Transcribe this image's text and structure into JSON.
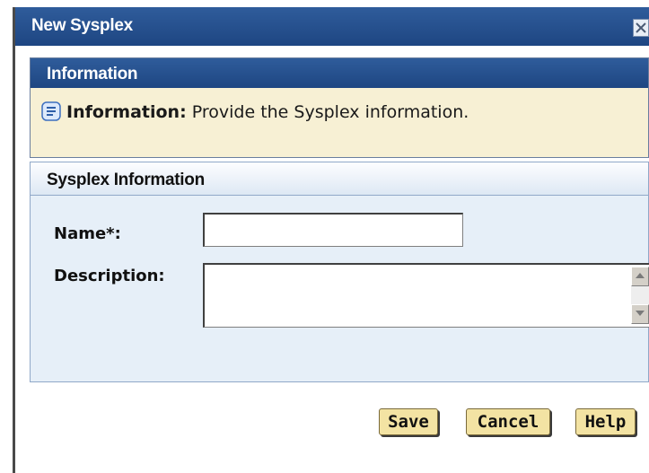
{
  "dialog": {
    "title": "New Sysplex",
    "close_icon": "close-x-icon"
  },
  "info_section": {
    "header": "Information",
    "icon": "info-note-icon",
    "message_label": "Information:",
    "message_text": "Provide the Sysplex information."
  },
  "sysplex_section": {
    "header": "Sysplex Information",
    "name_label": "Name*:",
    "name_value": "",
    "description_label": "Description:",
    "description_value": ""
  },
  "buttons": {
    "save": "Save",
    "cancel": "Cancel",
    "help": "Help"
  },
  "colors": {
    "title_bar": "#1e4682",
    "info_background": "#f7f0d4",
    "section_background": "#e6eff8",
    "button_background": "#f3e3a3"
  }
}
